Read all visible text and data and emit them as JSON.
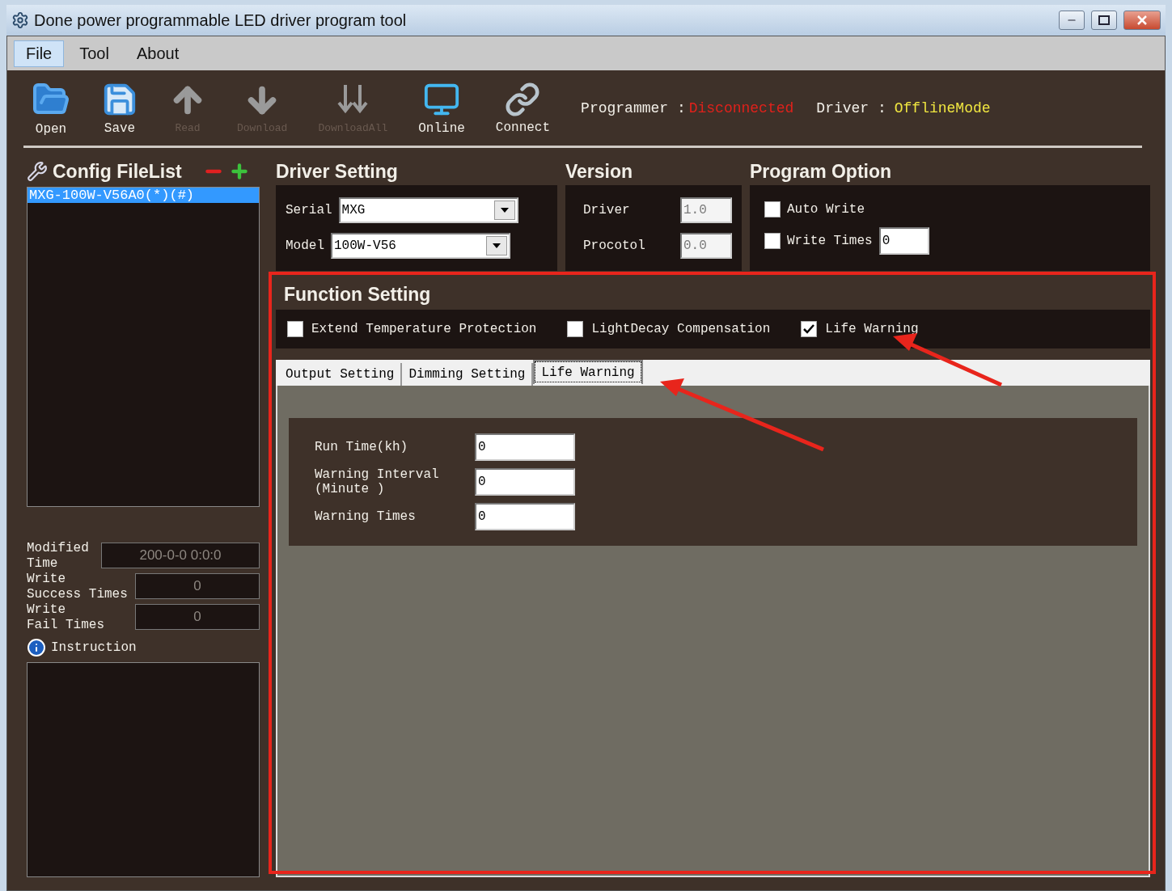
{
  "window": {
    "title": "Done power programmable LED driver program tool"
  },
  "menu": [
    {
      "label": "File",
      "selected": true
    },
    {
      "label": "Tool",
      "selected": false
    },
    {
      "label": "About",
      "selected": false
    }
  ],
  "toolbar": [
    {
      "kind": "open",
      "label": "Open",
      "disabled": false
    },
    {
      "kind": "save",
      "label": "Save",
      "disabled": false
    },
    {
      "kind": "read",
      "label": "Read",
      "disabled": true
    },
    {
      "kind": "download",
      "label": "Download",
      "disabled": true
    },
    {
      "kind": "downloadall",
      "label": "DownloadAll",
      "disabled": true
    },
    {
      "kind": "online",
      "label": "Online",
      "disabled": false
    },
    {
      "kind": "connect",
      "label": "Connect",
      "disabled": false
    }
  ],
  "status": {
    "programmer_label": "Programmer :",
    "programmer_value": "Disconnected",
    "driver_label": "Driver :",
    "driver_value": "OfflineMode"
  },
  "config_filelist": {
    "title": "Config FileList",
    "items": [
      {
        "label": "MXG-100W-V56A0(*)(#)",
        "selected": true
      }
    ]
  },
  "stats": [
    {
      "label": "Modified\nTime",
      "value": "200-0-0 0:0:0"
    },
    {
      "label": "Write\nSuccess Times",
      "value": "0"
    },
    {
      "label": "Write\nFail Times",
      "value": "0"
    }
  ],
  "instruction": {
    "title": "Instruction"
  },
  "driver_setting": {
    "title": "Driver Setting",
    "fields": [
      {
        "label": "Serial",
        "value": "MXG"
      },
      {
        "label": "Model",
        "value": "100W-V56"
      }
    ]
  },
  "version": {
    "title": "Version",
    "fields": [
      {
        "label": "Driver",
        "value": "1.0"
      },
      {
        "label": "Procotol",
        "value": "0.0"
      }
    ]
  },
  "program_option": {
    "title": "Program Option",
    "items": [
      {
        "kind": "checkbox",
        "label": "Auto Write",
        "checked": false
      },
      {
        "kind": "checkbox_input",
        "label": "Write Times",
        "checked": false,
        "value": "0"
      }
    ]
  },
  "function_setting": {
    "title": "Function Setting",
    "options": [
      {
        "label": "Extend Temperature Protection",
        "checked": false
      },
      {
        "label": "LightDecay Compensation",
        "checked": false
      },
      {
        "label": "Life Warning",
        "checked": true
      }
    ],
    "tabs": [
      {
        "label": "Output Setting",
        "selected": false
      },
      {
        "label": "Dimming Setting",
        "selected": false
      },
      {
        "label": "Life Warning",
        "selected": true
      }
    ],
    "fields": [
      {
        "label": "Run Time(kh)",
        "value": "0"
      },
      {
        "label": "Warning Interval\n(Minute )",
        "value": "0"
      },
      {
        "label": "Warning Times",
        "value": "0"
      }
    ]
  }
}
